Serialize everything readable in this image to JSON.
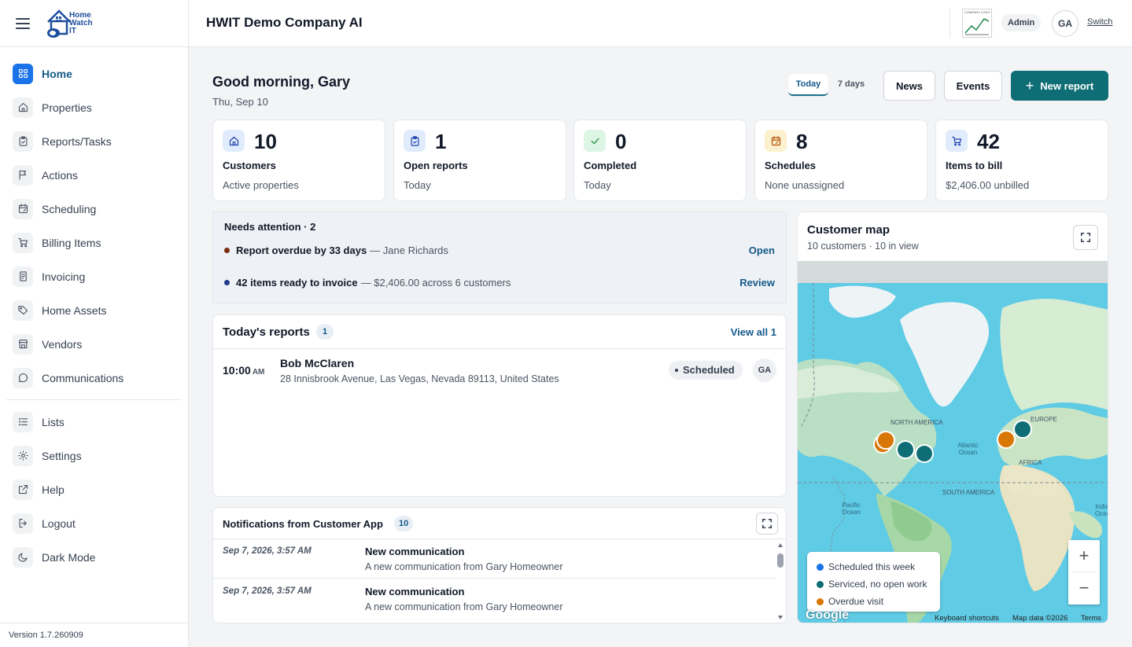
{
  "sidebar": {
    "logo_text": "Home Watch IT",
    "logo_lines": [
      "Home",
      "Watch",
      "IT"
    ],
    "items": [
      {
        "label": "Home",
        "icon": "grid-icon",
        "active": true
      },
      {
        "label": "Properties",
        "icon": "house-icon"
      },
      {
        "label": "Reports/Tasks",
        "icon": "clipboard-icon"
      },
      {
        "label": "Actions",
        "icon": "flag-icon"
      },
      {
        "label": "Scheduling",
        "icon": "calendar-icon"
      },
      {
        "label": "Billing Items",
        "icon": "cart-icon"
      },
      {
        "label": "Invoicing",
        "icon": "invoice-icon"
      },
      {
        "label": "Home Assets",
        "icon": "tag-icon"
      },
      {
        "label": "Vendors",
        "icon": "store-icon"
      },
      {
        "label": "Communications",
        "icon": "chat-icon"
      }
    ],
    "secondary_items": [
      {
        "label": "Lists",
        "icon": "list-icon"
      },
      {
        "label": "Settings",
        "icon": "gear-icon"
      },
      {
        "label": "Help",
        "icon": "external-link-icon"
      },
      {
        "label": "Logout",
        "icon": "logout-icon"
      },
      {
        "label": "Dark Mode",
        "icon": "moon-icon"
      }
    ],
    "version": "Version 1.7.260909"
  },
  "header": {
    "company": "HWIT Demo Company AI",
    "company_logo_text": "COMPANY LOGO",
    "role": "Admin",
    "avatar": "GA",
    "switch_label": "Switch"
  },
  "main": {
    "greeting": "Good morning, Gary",
    "date": "Thu, Sep 10",
    "range_today": "Today",
    "range_7days": "7 days",
    "news_label": "News",
    "events_label": "Events",
    "new_report_label": "New report",
    "stats": [
      {
        "value": "10",
        "title": "Customers",
        "sub": "Active properties",
        "icon": "house-icon",
        "color": "#1e40af",
        "bg": "#e0ecfb"
      },
      {
        "value": "1",
        "title": "Open reports",
        "sub": "Today",
        "icon": "clipboard-check-icon",
        "color": "#1e40af",
        "bg": "#e0ecfb"
      },
      {
        "value": "0",
        "title": "Completed",
        "sub": "Today",
        "icon": "check-icon",
        "color": "#15803d",
        "bg": "#dcf5e4"
      },
      {
        "value": "8",
        "title": "Schedules",
        "sub": "None unassigned",
        "icon": "calendar-edit-icon",
        "color": "#b45309",
        "bg": "#fdf0cf"
      },
      {
        "value": "42",
        "title": "Items to bill",
        "sub": "$2,406.00 unbilled",
        "icon": "cart-icon",
        "color": "#1e40af",
        "bg": "#e0ecfb"
      }
    ],
    "attention": {
      "title": "Needs attention · 2",
      "rows": [
        {
          "bold": "Report overdue by 33 days",
          "rest": "— Jane Richards",
          "action": "Open",
          "dot_color": "#7c2d12"
        },
        {
          "bold": "42 items ready to invoice",
          "rest": "— $2,406.00 across 6 customers",
          "action": "Review",
          "dot_color": "#1e3a8a"
        }
      ]
    },
    "reports": {
      "title": "Today's reports",
      "count": "1",
      "view_all": "View all 1",
      "items": [
        {
          "time": "10:00",
          "ampm": "AM",
          "name": "Bob McClaren",
          "address": "28 Innisbrook Avenue, Las Vegas, Nevada 89113, United States",
          "status": "Scheduled",
          "assignee": "GA"
        }
      ]
    },
    "notifications": {
      "title": "Notifications from Customer App",
      "count": "10",
      "items": [
        {
          "date": "Sep 7, 2026, 3:57 AM",
          "title": "New communication",
          "desc": "A new communication from Gary Homeowner"
        },
        {
          "date": "Sep 7, 2026, 3:57 AM",
          "title": "New communication",
          "desc": "A new communication from Gary Homeowner"
        }
      ]
    }
  },
  "map": {
    "title": "Customer map",
    "sub": "10 customers · 10 in view",
    "labels": {
      "north_america": "NORTH AMERICA",
      "south_america": "SOUTH AMERICA",
      "europe": "EUROPE",
      "africa": "AFRICA",
      "atlantic": "Atlantic Ocean",
      "pacific": "Pacific Ocean",
      "indian": "India Ocea"
    },
    "legend": [
      {
        "label": "Scheduled this week",
        "color": "#1a73e8"
      },
      {
        "label": "Serviced, no open work",
        "color": "#0f6e75"
      },
      {
        "label": "Overdue visit",
        "color": "#d97706"
      }
    ],
    "attribution": {
      "google": "Google",
      "shortcuts": "Keyboard shortcuts",
      "data": "Map data ©2026",
      "terms": "Terms"
    },
    "zoom_in": "+",
    "zoom_out": "−"
  }
}
